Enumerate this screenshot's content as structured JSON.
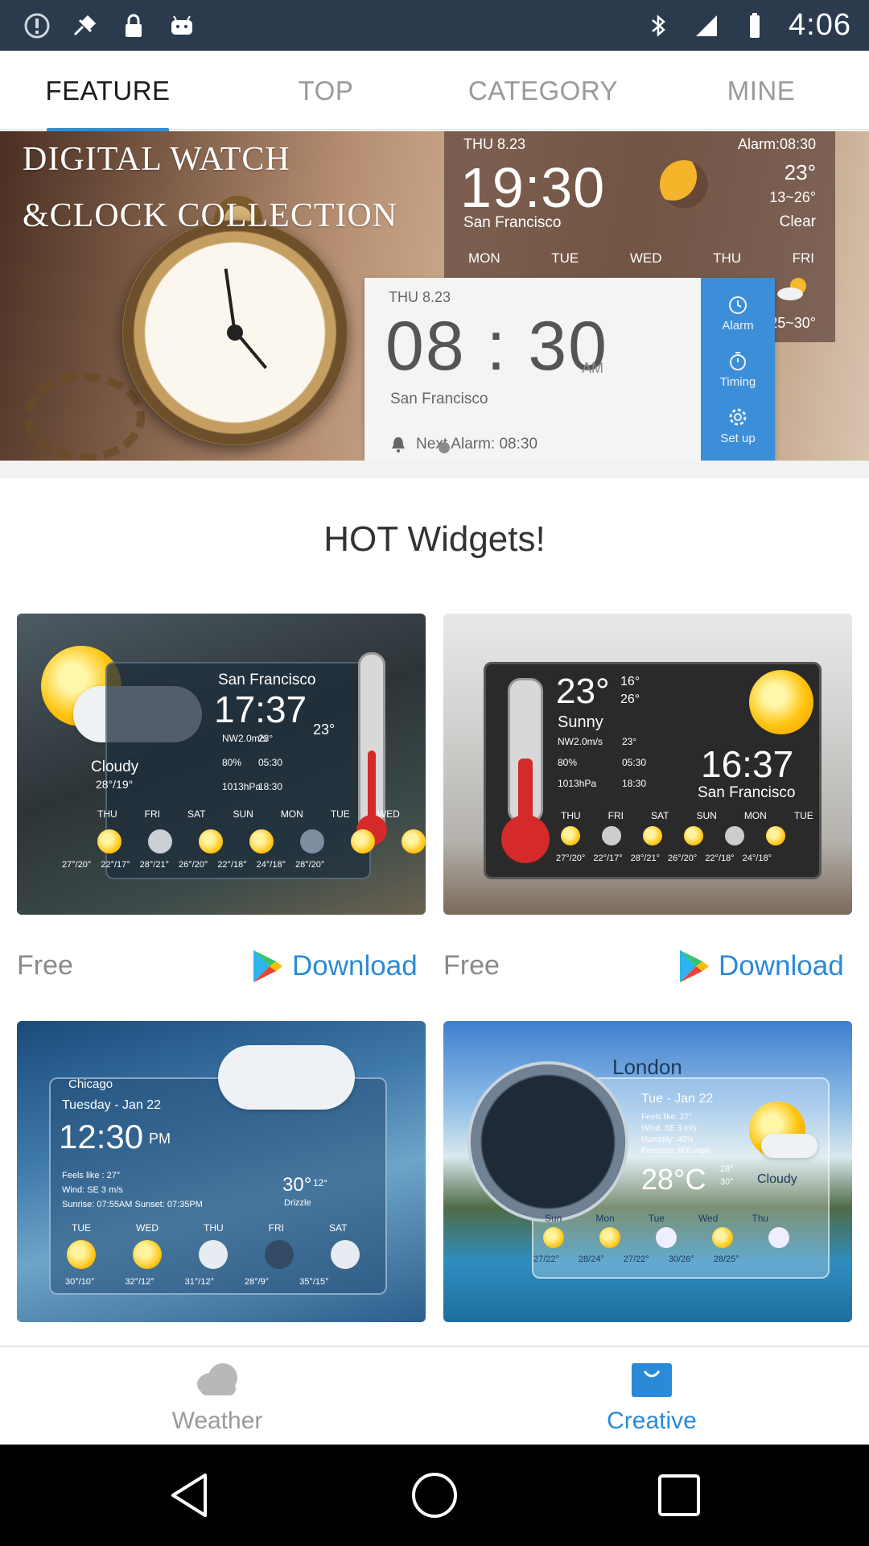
{
  "status_bar": {
    "time": "4:06",
    "icons_left": [
      "alert-icon",
      "fake-gps-icon",
      "lock-icon",
      "android-icon"
    ],
    "icons_right": [
      "bluetooth-icon",
      "signal-icon",
      "battery-icon"
    ]
  },
  "tabs": [
    {
      "label": "FEATURE",
      "active": true
    },
    {
      "label": "TOP",
      "active": false
    },
    {
      "label": "CATEGORY",
      "active": false
    },
    {
      "label": "MINE",
      "active": false
    }
  ],
  "banner": {
    "title_line1": "DIGITAL WATCH",
    "title_line2": "&CLOCK COLLECTION",
    "back_widget": {
      "date": "THU 8.23",
      "alarm": "Alarm:08:30",
      "time": "19:30",
      "city": "San Francisco",
      "temp": "23°",
      "range": "13~26°",
      "condition": "Clear",
      "days": [
        "MON",
        "TUE",
        "WED",
        "THU",
        "FRI"
      ],
      "fri_range": "25~30°"
    },
    "front_widget": {
      "date": "THU 8.23",
      "time": "08 : 30",
      "ampm": "AM",
      "city": "San Francisco",
      "next_alarm": "Next Alarm: 08:30",
      "side": [
        "Alarm",
        "Timing",
        "Set up"
      ]
    }
  },
  "section": {
    "title": "HOT Widgets!"
  },
  "cards": [
    {
      "city": "San Francisco",
      "time": "17:37",
      "condition": "Cloudy",
      "range": "28°/19°",
      "temp": "23°",
      "details": [
        "NW2.0m/s",
        "80%",
        "1013hPa"
      ],
      "details2": [
        "23°",
        "05:30",
        "18:30"
      ],
      "days": [
        "THU",
        "FRI",
        "SAT",
        "SUN",
        "MON",
        "TUE",
        "WED"
      ],
      "ranges": [
        "27°/20°",
        "22°/17°",
        "28°/21°",
        "26°/20°",
        "22°/18°",
        "24°/18°",
        "28°/20°"
      ],
      "price": "Free",
      "download": "Download"
    },
    {
      "temp": "23°",
      "hi_lo": "16°",
      "hi_lo2": "26°",
      "condition": "Sunny",
      "time": "16:37",
      "city": "San Francisco",
      "details": [
        "NW2.0m/s",
        "80%",
        "1013hPa"
      ],
      "details2": [
        "23°",
        "05:30",
        "18:30"
      ],
      "days": [
        "THU",
        "FRI",
        "SAT",
        "SUN",
        "MON",
        "TUE"
      ],
      "ranges": [
        "27°/20°",
        "22°/17°",
        "28°/21°",
        "26°/20°",
        "22°/18°",
        "24°/18°"
      ],
      "price": "Free",
      "download": "Download"
    },
    {
      "city": "Chicago",
      "date": "Tuesday - Jan 22",
      "time": "12:30",
      "ampm": "PM",
      "feels": "Feels like : 27°",
      "wind": "Wind: SE 3 m/s",
      "sun": "Sunrise: 07:55AM   Sunset: 07:35PM",
      "temp": "30°",
      "temp2": "12°",
      "condition": "Drizzle",
      "days": [
        "TUE",
        "WED",
        "THU",
        "FRI",
        "SAT"
      ],
      "ranges": [
        "30°/10°",
        "32°/12°",
        "31°/12°",
        "28°/9°",
        "35°/15°"
      ]
    },
    {
      "city": "London",
      "date": "Tue - Jan 22",
      "details": [
        "Feels like: 27°",
        "Wind: SE 3 m/s",
        "Humidity: 40%",
        "Pressure: 800 mph"
      ],
      "temp": "28°C",
      "hi": "28°",
      "lo": "30°",
      "condition": "Cloudy",
      "days": [
        "Sun",
        "Mon",
        "Tue",
        "Wed",
        "Thu"
      ],
      "ranges": [
        "27/22°",
        "28/24°",
        "27/22°",
        "30/26°",
        "28/25°"
      ]
    }
  ],
  "bottom_nav": [
    {
      "label": "Weather",
      "icon": "cloud-icon",
      "active": false
    },
    {
      "label": "Creative",
      "icon": "bag-icon",
      "active": true
    }
  ],
  "colors": {
    "accent": "#2c8fd8",
    "status_bar": "#2b3a4d",
    "inactive": "#9a9a9a"
  }
}
